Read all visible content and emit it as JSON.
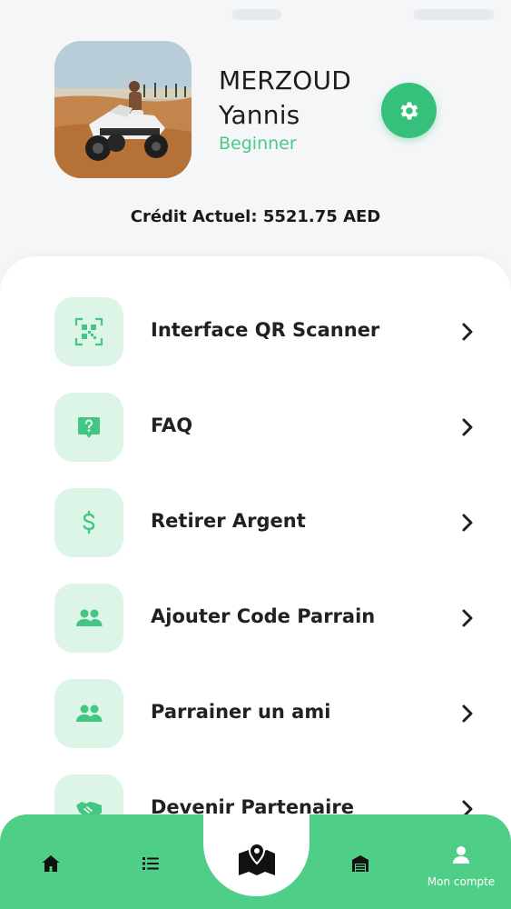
{
  "profile": {
    "first_name": "MERZOUD",
    "last_name": "Yannis",
    "level": "Beginner",
    "credit": "Crédit Actuel: 5521.75 AED"
  },
  "menu": [
    {
      "label": "Interface QR Scanner",
      "icon": "qr-code-icon"
    },
    {
      "label": "FAQ",
      "icon": "question-bubble-icon"
    },
    {
      "label": "Retirer Argent",
      "icon": "dollar-icon"
    },
    {
      "label": "Ajouter Code Parrain",
      "icon": "users-icon"
    },
    {
      "label": "Parrainer un ami",
      "icon": "users-icon"
    },
    {
      "label": "Devenir Partenaire",
      "icon": "handshake-icon"
    }
  ],
  "nav": {
    "items": [
      {
        "icon": "home-icon"
      },
      {
        "icon": "list-icon"
      },
      {
        "icon": "map-pin-icon"
      },
      {
        "icon": "garage-icon"
      },
      {
        "icon": "user-icon"
      }
    ],
    "account_label": "Mon compte"
  },
  "colors": {
    "accent": "#35c17c",
    "nav_bg": "#4fce88",
    "icon_tile": "#ddf5e7",
    "level_text": "#4cc98a"
  }
}
